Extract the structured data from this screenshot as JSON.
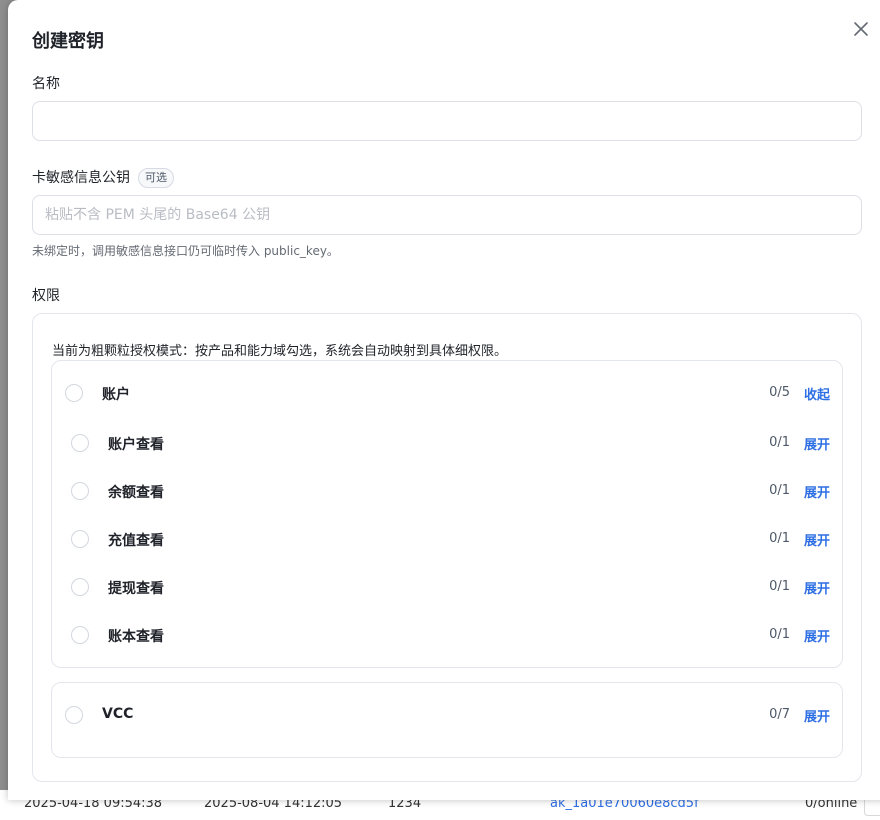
{
  "dialog": {
    "title": "创建密钥",
    "close_icon": "close-icon"
  },
  "form": {
    "name_label": "名称",
    "name_value": "",
    "name_placeholder": "",
    "public_key_label": "卡敏感信息公钥",
    "public_key_badge": "可选",
    "public_key_placeholder": "粘贴不含 PEM 头尾的 Base64 公钥",
    "public_key_value": "",
    "public_key_hint": "未绑定时，调用敏感信息接口仍可临时传入 public_key。",
    "permissions_label": "权限"
  },
  "permissions": {
    "description": "当前为粗颗粒授权模式：按产品和能力域勾选，系统会自动映射到具体细权限。",
    "groups": [
      {
        "label": "账户",
        "count": "0/5",
        "action": "收起",
        "items": [
          {
            "label": "账户查看",
            "count": "0/1",
            "action": "展开"
          },
          {
            "label": "余额查看",
            "count": "0/1",
            "action": "展开"
          },
          {
            "label": "充值查看",
            "count": "0/1",
            "action": "展开"
          },
          {
            "label": "提现查看",
            "count": "0/1",
            "action": "展开"
          },
          {
            "label": "账本查看",
            "count": "0/1",
            "action": "展开"
          }
        ]
      },
      {
        "label": "VCC",
        "count": "0/7",
        "action": "展开"
      }
    ]
  },
  "backdrop": {
    "col1": "2025-04-18 09:54:38",
    "col2": "2025-08-04 14:12:05",
    "col3": "1234",
    "col4": "ak_1a01e70060e8cd5f",
    "col5": "0/online"
  },
  "colors": {
    "accent": "#2f6fe4",
    "border": "#e3e6eb",
    "text": "#1f2329"
  }
}
